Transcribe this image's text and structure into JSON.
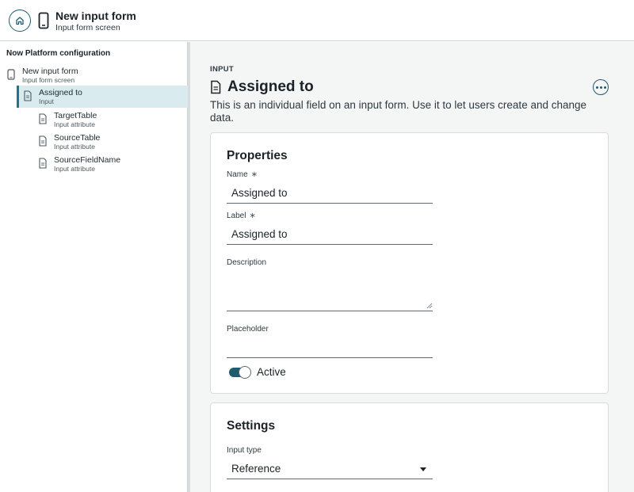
{
  "header": {
    "title": "New input form",
    "subtitle": "Input form screen",
    "home_icon": "home-icon",
    "device_icon": "mobile-device-icon"
  },
  "sidebar": {
    "heading": "Now Platform configuration",
    "items": [
      {
        "label": "New input form",
        "sublabel": "Input form screen",
        "icon": "mobile-device-icon"
      },
      {
        "label": "Assigned to",
        "sublabel": "Input",
        "icon": "document-icon",
        "selected": true
      },
      {
        "label": "TargetTable",
        "sublabel": "Input attribute",
        "icon": "document-icon"
      },
      {
        "label": "SourceTable",
        "sublabel": "Input attribute",
        "icon": "document-icon"
      },
      {
        "label": "SourceFieldName",
        "sublabel": "Input attribute",
        "icon": "document-icon"
      }
    ]
  },
  "main": {
    "eyebrow": "INPUT",
    "title": "Assigned to",
    "description": "This is an individual field on an input form. Use it to let users create and change data.",
    "more_icon": "more-options-icon",
    "properties": {
      "title": "Properties",
      "name_label": "Name",
      "name_value": "Assigned to",
      "label_label": "Label",
      "label_value": "Assigned to",
      "required_mark": "∗",
      "description_label": "Description",
      "description_value": "",
      "placeholder_label": "Placeholder",
      "placeholder_value": "",
      "active_label": "Active",
      "active": true
    },
    "settings": {
      "title": "Settings",
      "input_type_label": "Input type",
      "input_type_value": "Reference"
    }
  },
  "colors": {
    "accent": "#1f5c70",
    "selected_bg": "#d9ebee",
    "selected_border": "#167b86",
    "main_bg": "#f4f5f5"
  }
}
